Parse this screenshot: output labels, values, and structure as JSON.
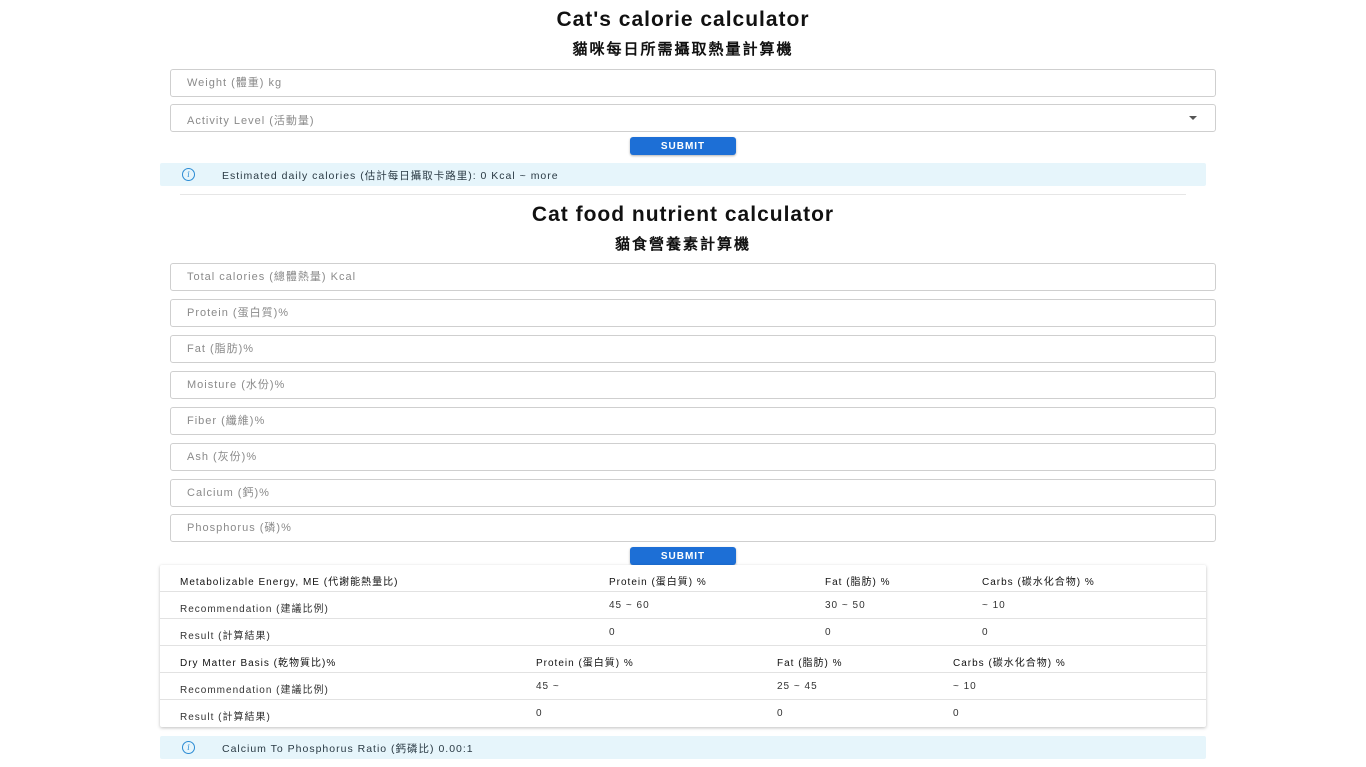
{
  "calorie_section": {
    "title": "Cat's calorie calculator",
    "subtitle": "貓咪每日所需攝取熱量計算機",
    "weight_placeholder": "Weight (體重) kg",
    "activity_placeholder": "Activity Level (活動量)",
    "submit_label": "SUBMIT",
    "result_text": "Estimated daily calories (估計每日攝取卡路里): 0 Kcal ~ more"
  },
  "nutrient_section": {
    "title": "Cat food nutrient calculator",
    "subtitle": "貓食營養素計算機",
    "fields": [
      {
        "placeholder": "Total calories (總體熱量) Kcal"
      },
      {
        "placeholder": "Protein (蛋白質)%"
      },
      {
        "placeholder": "Fat (脂肪)%"
      },
      {
        "placeholder": "Moisture (水份)%"
      },
      {
        "placeholder": "Fiber (纖維)%"
      },
      {
        "placeholder": "Ash (灰份)%"
      },
      {
        "placeholder": "Calcium (鈣)%"
      },
      {
        "placeholder": "Phosphorus (磷)%"
      }
    ],
    "submit_label": "SUBMIT"
  },
  "me_table": {
    "headers": [
      "Metabolizable Energy, ME (代謝能熱量比)",
      "Protein (蛋白質) %",
      "Fat (脂肪) %",
      "Carbs (碳水化合物) %"
    ],
    "rows": [
      [
        "Recommendation (建議比例)",
        "45 ~ 60",
        "30 ~ 50",
        "~ 10"
      ],
      [
        "Result (計算結果)",
        "0",
        "0",
        "0"
      ]
    ]
  },
  "dm_table": {
    "headers": [
      "Dry Matter Basis (乾物質比)%",
      "Protein (蛋白質) %",
      "Fat (脂肪) %",
      "Carbs (碳水化合物) %"
    ],
    "rows": [
      [
        "Recommendation (建議比例)",
        "45 ~",
        "25 ~ 45",
        "~ 10"
      ],
      [
        "Result (計算結果)",
        "0",
        "0",
        "0"
      ]
    ]
  },
  "ratio_text": "Calcium To Phosphorus Ratio (鈣磷比) 0.00:1",
  "colors": {
    "primary": "#1d6fd6",
    "info_bg": "#e6f5fb",
    "info_icon": "#2b8bd4"
  },
  "icons": {
    "info": "info-circle-icon",
    "dropdown": "chevron-down-icon"
  }
}
